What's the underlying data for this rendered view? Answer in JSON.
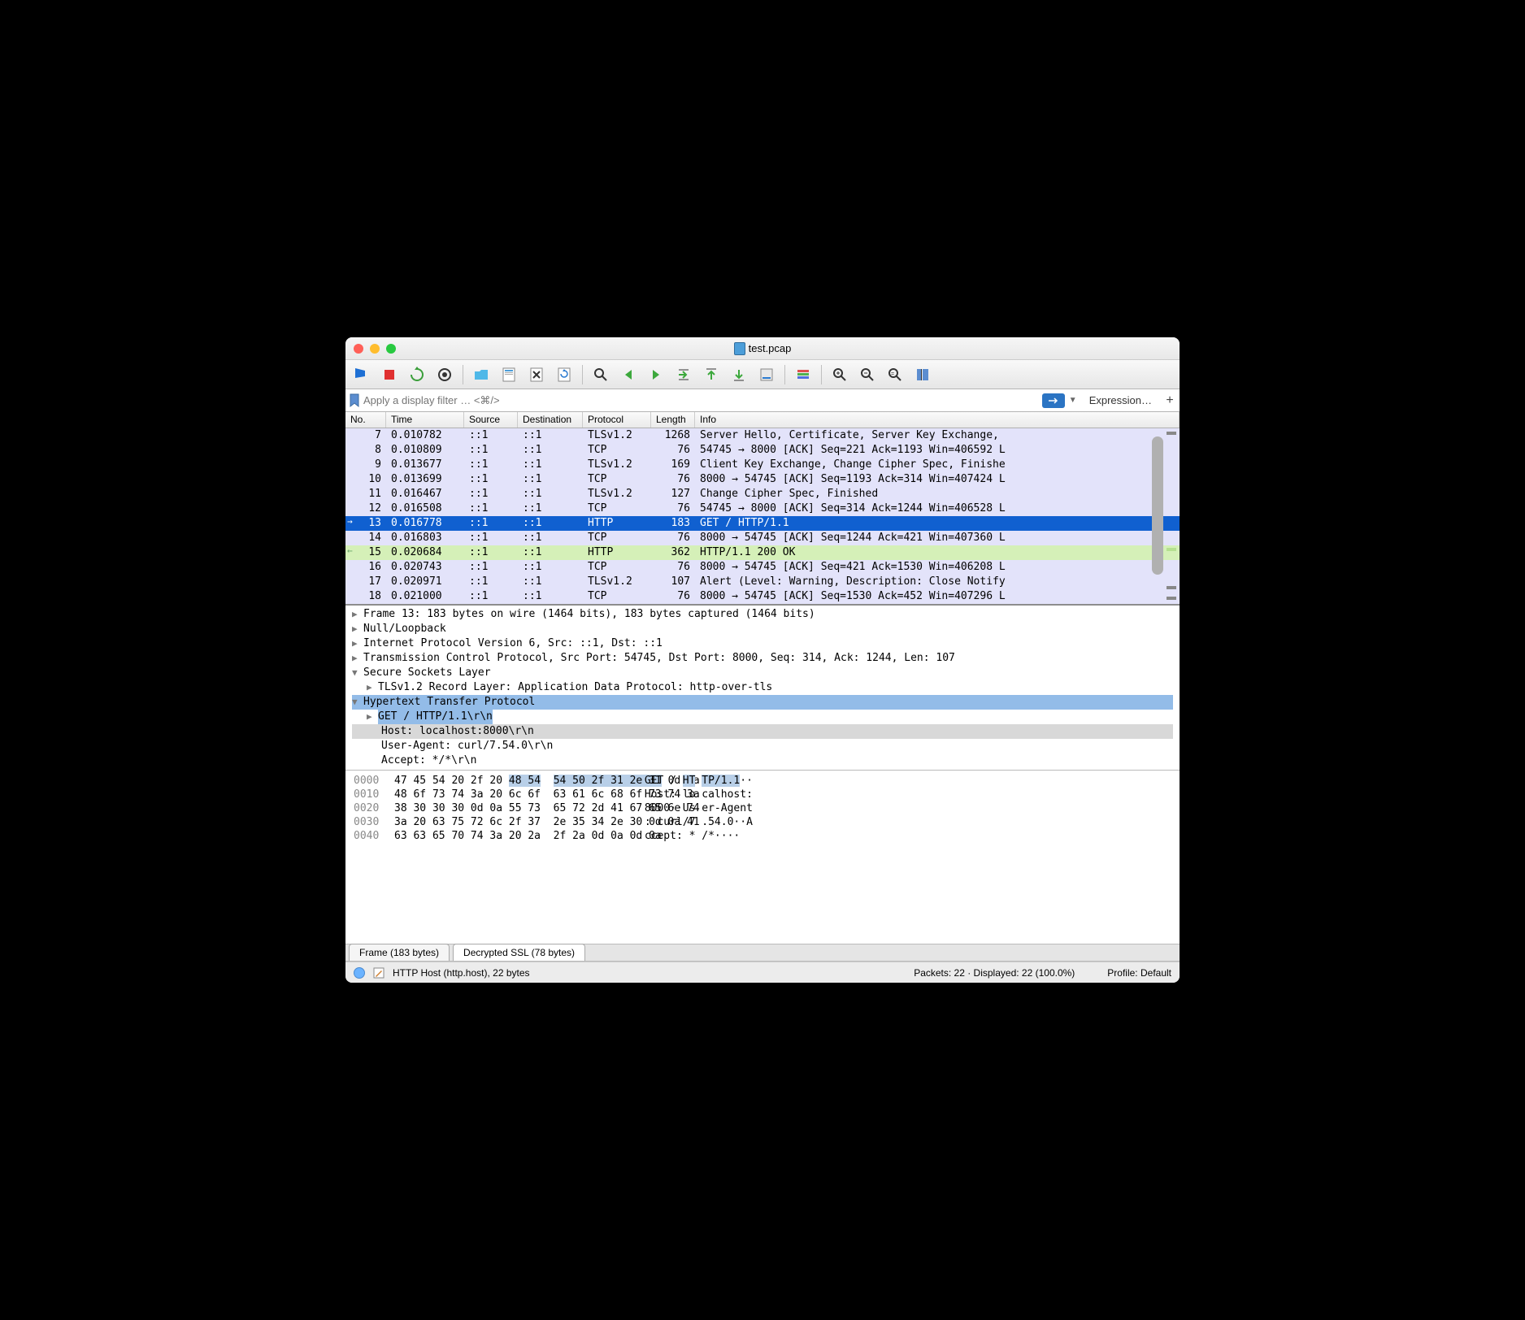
{
  "title": "test.pcap",
  "filter": {
    "placeholder": "Apply a display filter … <⌘/>",
    "expression_label": "Expression…"
  },
  "columns": {
    "no": "No.",
    "time": "Time",
    "source": "Source",
    "destination": "Destination",
    "protocol": "Protocol",
    "length": "Length",
    "info": "Info"
  },
  "packets": [
    {
      "no": "7",
      "time": "0.010782",
      "src": "::1",
      "dst": "::1",
      "proto": "TLSv1.2",
      "len": "1268",
      "info": "Server Hello, Certificate, Server Key Exchange,",
      "cls": "lav"
    },
    {
      "no": "8",
      "time": "0.010809",
      "src": "::1",
      "dst": "::1",
      "proto": "TCP",
      "len": "76",
      "info": "54745 → 8000 [ACK] Seq=221 Ack=1193 Win=406592 L",
      "cls": "lav"
    },
    {
      "no": "9",
      "time": "0.013677",
      "src": "::1",
      "dst": "::1",
      "proto": "TLSv1.2",
      "len": "169",
      "info": "Client Key Exchange, Change Cipher Spec, Finishe",
      "cls": "lav"
    },
    {
      "no": "10",
      "time": "0.013699",
      "src": "::1",
      "dst": "::1",
      "proto": "TCP",
      "len": "76",
      "info": "8000 → 54745 [ACK] Seq=1193 Ack=314 Win=407424 L",
      "cls": "lav"
    },
    {
      "no": "11",
      "time": "0.016467",
      "src": "::1",
      "dst": "::1",
      "proto": "TLSv1.2",
      "len": "127",
      "info": "Change Cipher Spec, Finished",
      "cls": "lav"
    },
    {
      "no": "12",
      "time": "0.016508",
      "src": "::1",
      "dst": "::1",
      "proto": "TCP",
      "len": "76",
      "info": "54745 → 8000 [ACK] Seq=314 Ack=1244 Win=406528 L",
      "cls": "lav"
    },
    {
      "no": "13",
      "time": "0.016778",
      "src": "::1",
      "dst": "::1",
      "proto": "HTTP",
      "len": "183",
      "info": "GET / HTTP/1.1",
      "cls": "sel"
    },
    {
      "no": "14",
      "time": "0.016803",
      "src": "::1",
      "dst": "::1",
      "proto": "TCP",
      "len": "76",
      "info": "8000 → 54745 [ACK] Seq=1244 Ack=421 Win=407360 L",
      "cls": "lav"
    },
    {
      "no": "15",
      "time": "0.020684",
      "src": "::1",
      "dst": "::1",
      "proto": "HTTP",
      "len": "362",
      "info": "HTTP/1.1 200 OK",
      "cls": "grn"
    },
    {
      "no": "16",
      "time": "0.020743",
      "src": "::1",
      "dst": "::1",
      "proto": "TCP",
      "len": "76",
      "info": "8000 → 54745 [ACK] Seq=421 Ack=1530 Win=406208 L",
      "cls": "lav"
    },
    {
      "no": "17",
      "time": "0.020971",
      "src": "::1",
      "dst": "::1",
      "proto": "TLSv1.2",
      "len": "107",
      "info": "Alert (Level: Warning, Description: Close Notify",
      "cls": "lav"
    },
    {
      "no": "18",
      "time": "0.021000",
      "src": "::1",
      "dst": "::1",
      "proto": "TCP",
      "len": "76",
      "info": "8000 → 54745 [ACK] Seq=1530 Ack=452 Win=407296 L",
      "cls": "lav"
    }
  ],
  "details": {
    "frame": "Frame 13: 183 bytes on wire (1464 bits), 183 bytes captured (1464 bits)",
    "null": "Null/Loopback",
    "ip": "Internet Protocol Version 6, Src: ::1, Dst: ::1",
    "tcp": "Transmission Control Protocol, Src Port: 54745, Dst Port: 8000, Seq: 314, Ack: 1244, Len: 107",
    "ssl": "Secure Sockets Layer",
    "tls": "TLSv1.2 Record Layer: Application Data Protocol: http-over-tls",
    "http": "Hypertext Transfer Protocol",
    "get": "GET / HTTP/1.1\\r\\n",
    "host": "Host: localhost:8000\\r\\n",
    "ua": "User-Agent: curl/7.54.0\\r\\n",
    "accept": "Accept: */*\\r\\n"
  },
  "hex": [
    {
      "addr": "0000",
      "h1": "47 45 54 20 2f 20 ",
      "hhi": "48 54",
      "h2": "",
      "h3hi": "54 50 2f 31 2e 31",
      "h3": " 0d 0a",
      "a1": "GET / ",
      "ahi1": "HT",
      "a2": " ",
      "ahi2": "TP/1.1",
      "a3": "··"
    },
    {
      "addr": "0010",
      "h1": "48 6f 73 74 3a 20 6c 6f",
      "hhi": "",
      "h2": "",
      "h3hi": "",
      "h3": "63 61 6c 68 6f 73 74 3a",
      "a1": "Host: lo",
      "ahi1": "",
      "a2": " ",
      "ahi2": "",
      "a3": "calhost:"
    },
    {
      "addr": "0020",
      "h1": "38 30 30 30 0d 0a 55 73",
      "hhi": "",
      "h2": "",
      "h3hi": "",
      "h3": "65 72 2d 41 67 65 6e 74",
      "a1": "8000··Us",
      "ahi1": "",
      "a2": " ",
      "ahi2": "",
      "a3": "er-Agent"
    },
    {
      "addr": "0030",
      "h1": "3a 20 63 75 72 6c 2f 37",
      "hhi": "",
      "h2": "",
      "h3hi": "",
      "h3": "2e 35 34 2e 30 0d 0a 41",
      "a1": ": curl/7",
      "ahi1": "",
      "a2": " ",
      "ahi2": "",
      "a3": ".54.0··A"
    },
    {
      "addr": "0040",
      "h1": "63 63 65 70 74 3a 20 2a",
      "hhi": "",
      "h2": "",
      "h3hi": "",
      "h3": "2f 2a 0d 0a 0d 0a",
      "a1": "ccept: *",
      "ahi1": "",
      "a2": " ",
      "ahi2": "",
      "a3": "/*····"
    }
  ],
  "tabs": {
    "frame": "Frame (183 bytes)",
    "ssl": "Decrypted SSL (78 bytes)"
  },
  "status": {
    "left": "HTTP Host (http.host), 22 bytes",
    "right": "Packets: 22 · Displayed: 22 (100.0%)",
    "profile": "Profile: Default"
  }
}
